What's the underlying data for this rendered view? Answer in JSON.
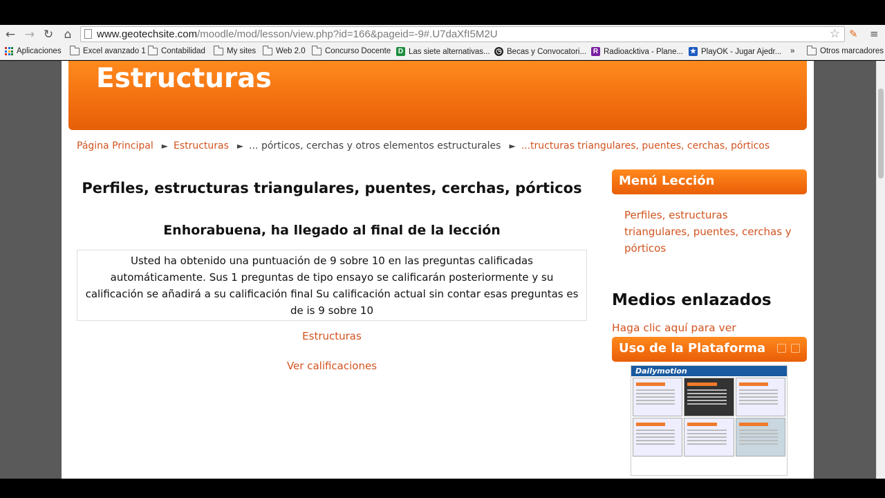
{
  "browser": {
    "url_domain": "www.geotechsite.com",
    "url_path": "/moodle/mod/lesson/view.php?id=166&pageid=-9#.U7daXfI5M2U",
    "bookmarks": [
      {
        "label": "Aplicaciones",
        "icon": "apps-icon"
      },
      {
        "label": "Excel avanzado 1",
        "icon": "folder-icon"
      },
      {
        "label": "Contabilidad",
        "icon": "folder-icon"
      },
      {
        "label": "My sites",
        "icon": "folder-icon"
      },
      {
        "label": "Web 2.0",
        "icon": "folder-icon"
      },
      {
        "label": "Concurso Docente",
        "icon": "folder-icon"
      },
      {
        "label": "Las siete alternativas...",
        "icon": "d-favicon"
      },
      {
        "label": "Becas y Convocatori...",
        "icon": "clock-favicon"
      },
      {
        "label": "Radioacktiva - Plane...",
        "icon": "r-favicon"
      },
      {
        "label": "PlayOK - Jugar Ajedr...",
        "icon": "star-favicon"
      },
      {
        "label": "»",
        "icon": ""
      },
      {
        "label": "Otros marcadores",
        "icon": "folder-icon"
      }
    ]
  },
  "page": {
    "banner_title": "Estructuras",
    "breadcrumb": [
      "Página Principal",
      "Estructuras",
      "... pórticos, cerchas y otros elementos estructurales",
      "...tructuras triangulares, puentes, cerchas, pórticos"
    ],
    "lesson_title": "Perfiles, estructuras triangulares, puentes, cerchas, pórticos",
    "congrats": "Enhorabuena, ha llegado al final de la lección",
    "score_text": "Usted ha obtenido una puntuación de 9 sobre 10 en las preguntas calificadas automáticamente. Sus 1 preguntas de tipo ensayo se calificarán posteriormente y su calificación se añadirá a su calificación final Su calificación actual sin contar esas preguntas es de is 9 sobre 10",
    "link_course": "Estructuras",
    "link_grades": "Ver calificaciones"
  },
  "sidebar": {
    "menu_heading": "Menú Lección",
    "menu_item": "Perfiles, estructuras triangulares, puentes, cerchas y pórticos",
    "media_heading": "Medios enlazados",
    "media_link": "Haga clic aquí para ver",
    "platform_heading": "Uso de la Plataforma",
    "video_brand": "Dailymotion"
  },
  "colors": {
    "accent": "#f0700f",
    "link": "#d2531f"
  }
}
